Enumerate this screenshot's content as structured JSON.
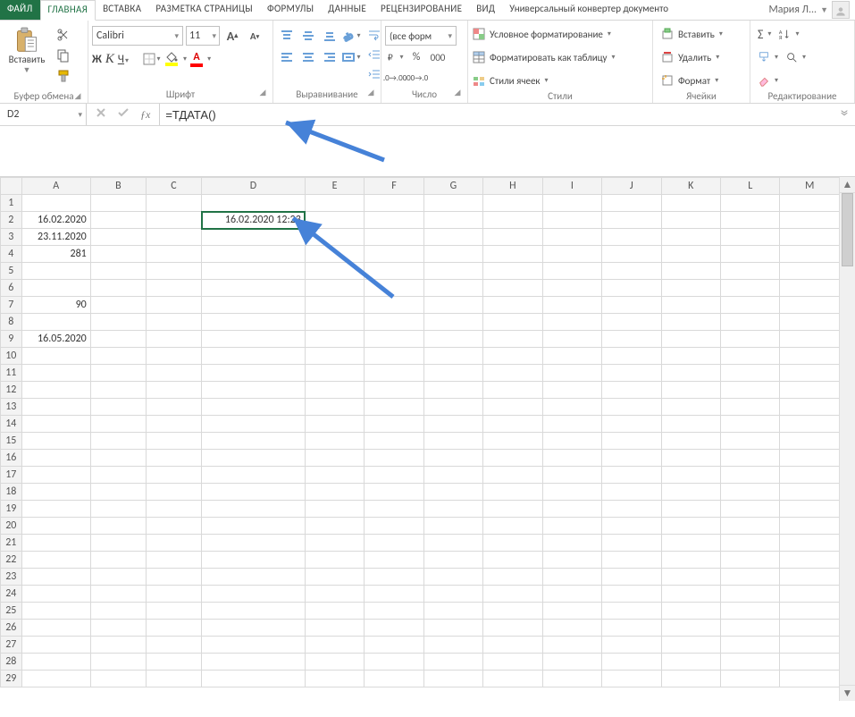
{
  "tabs": {
    "file": "ФАЙЛ",
    "home": "ГЛАВНАЯ",
    "insert": "ВСТАВКА",
    "pagelayout": "РАЗМЕТКА СТРАНИЦЫ",
    "formulas": "ФОРМУЛЫ",
    "data": "ДАННЫЕ",
    "review": "РЕЦЕНЗИРОВАНИЕ",
    "view": "ВИД",
    "converter": "Универсальный конвертер документо"
  },
  "user": {
    "name": "Мария Л..."
  },
  "ribbon": {
    "clipboard": {
      "paste": "Вставить",
      "label": "Буфер обмена"
    },
    "font": {
      "name": "Calibri",
      "size": "11",
      "bold": "Ж",
      "italic": "К",
      "underline": "Ч",
      "label": "Шрифт"
    },
    "alignment": {
      "label": "Выравнивание"
    },
    "number": {
      "format": "(все форм",
      "label": "Число"
    },
    "styles": {
      "cond": "Условное форматирование",
      "table": "Форматировать как таблицу",
      "cell": "Стили ячеек",
      "label": "Стили"
    },
    "cells": {
      "insert": "Вставить",
      "delete": "Удалить",
      "format": "Формат",
      "label": "Ячейки"
    },
    "editing": {
      "label": "Редактирование"
    }
  },
  "formula_bar": {
    "namebox": "D2",
    "formula": "=ТДАТА()"
  },
  "columns": [
    "A",
    "B",
    "C",
    "D",
    "E",
    "F",
    "G",
    "H",
    "I",
    "J",
    "K",
    "L",
    "M"
  ],
  "rows": 29,
  "cells": {
    "A2": "16.02.2020",
    "A3": "23.11.2020",
    "A4": "281",
    "A7": "90",
    "A9": "16.05.2020",
    "D2": "16.02.2020 12:23"
  },
  "selected": "D2"
}
